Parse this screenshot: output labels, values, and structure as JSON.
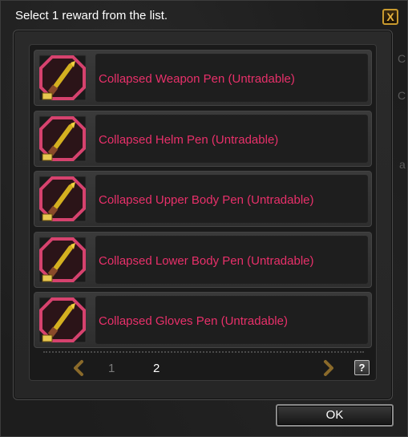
{
  "window": {
    "title": "Select 1 reward from the list.",
    "close_label": "X"
  },
  "rewards": [
    {
      "name": "Collapsed Weapon Pen (Untradable)",
      "icon": "pen-icon"
    },
    {
      "name": "Collapsed Helm Pen (Untradable)",
      "icon": "pen-icon"
    },
    {
      "name": "Collapsed Upper Body Pen (Untradable)",
      "icon": "pen-icon"
    },
    {
      "name": "Collapsed Lower Body Pen (Untradable)",
      "icon": "pen-icon"
    },
    {
      "name": "Collapsed Gloves Pen (Untradable)",
      "icon": "pen-icon"
    }
  ],
  "pagination": {
    "pages": [
      "1",
      "2"
    ],
    "current": "2",
    "prev_icon": "chevron-left-icon",
    "next_icon": "chevron-right-icon"
  },
  "help_label": "?",
  "ok_label": "OK",
  "colors": {
    "reward_text": "#e8306a",
    "accent_gold": "#c99a2e",
    "icon_border": "#d6426e"
  }
}
